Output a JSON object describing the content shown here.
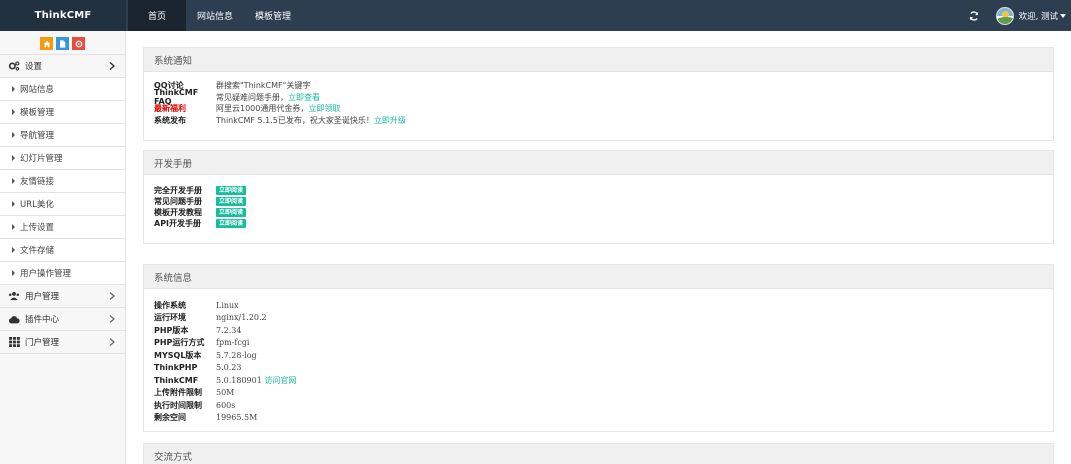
{
  "topbar": {
    "brand": "ThinkCMF",
    "nav": [
      "首页",
      "网站信息",
      "模板管理"
    ],
    "user": "欢迎, 测试"
  },
  "sidebar": {
    "groups": [
      {
        "label": "设置",
        "icon": "cogs-icon"
      },
      {
        "label": "用户管理",
        "icon": "users-icon"
      },
      {
        "label": "插件中心",
        "icon": "cloud-icon"
      },
      {
        "label": "门户管理",
        "icon": "th-icon"
      }
    ],
    "settings_items": [
      "网站信息",
      "模板管理",
      "导航管理",
      "幻灯片管理",
      "友情链接",
      "URL美化",
      "上传设置",
      "文件存储",
      "用户操作管理"
    ]
  },
  "notice": {
    "title": "系统通知",
    "rows": [
      {
        "k": "QQ讨论",
        "v": "群搜索\"ThinkCMF\"关键字",
        "link": ""
      },
      {
        "k": "ThinkCMF FAQ",
        "v": "常见疑难问题手册，",
        "link": "立即查看"
      },
      {
        "k": "最新福利",
        "v": "阿里云1000通用代金券，",
        "link": "立即领取"
      },
      {
        "k": "系统发布",
        "v": "ThinkCMF 5.1.5已发布，祝大家圣诞快乐！",
        "link": "立即升级"
      }
    ]
  },
  "manual": {
    "title": "开发手册",
    "badge": "立即阅读",
    "rows": [
      "完全开发手册",
      "常见问题手册",
      "模板开发教程",
      "API开发手册"
    ]
  },
  "sysinfo": {
    "title": "系统信息",
    "rows": [
      {
        "k": "操作系统",
        "v": "Linux",
        "link": ""
      },
      {
        "k": "运行环境",
        "v": "nginx/1.20.2",
        "link": ""
      },
      {
        "k": "PHP版本",
        "v": "7.2.34",
        "link": ""
      },
      {
        "k": "PHP运行方式",
        "v": "fpm-fcgi",
        "link": ""
      },
      {
        "k": "MYSQL版本",
        "v": "5.7.28-log",
        "link": ""
      },
      {
        "k": "ThinkPHP",
        "v": "5.0.23",
        "link": ""
      },
      {
        "k": "ThinkCMF",
        "v": "5.0.180901 ",
        "link": "访问官网"
      },
      {
        "k": "上传附件限制",
        "v": "50M",
        "link": ""
      },
      {
        "k": "执行时间限制",
        "v": "600s",
        "link": ""
      },
      {
        "k": "剩余空间",
        "v": "19965.5M",
        "link": ""
      }
    ]
  },
  "contact": {
    "title": "交流方式"
  }
}
